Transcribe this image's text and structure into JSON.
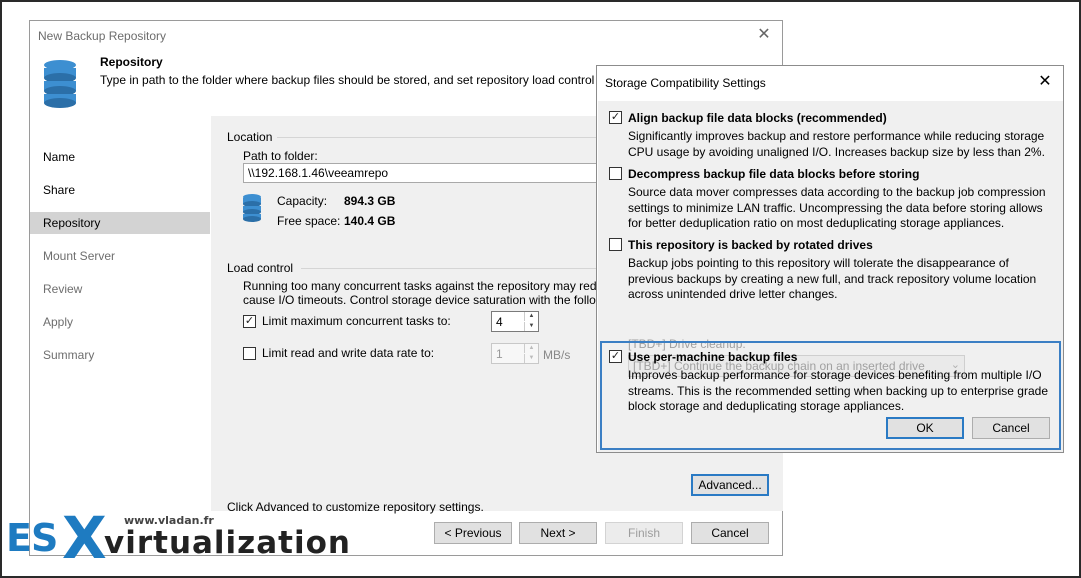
{
  "wizard": {
    "title": "New Backup Repository",
    "header_title": "Repository",
    "header_desc": "Type in path to the folder where backup files should be stored, and set repository load control",
    "nav": [
      {
        "label": "Name",
        "state": "normal"
      },
      {
        "label": "Share",
        "state": "normal"
      },
      {
        "label": "Repository",
        "state": "selected"
      },
      {
        "label": "Mount Server",
        "state": "disabled"
      },
      {
        "label": "Review",
        "state": "disabled"
      },
      {
        "label": "Apply",
        "state": "disabled"
      },
      {
        "label": "Summary",
        "state": "disabled"
      }
    ],
    "location": {
      "section_label": "Location",
      "path_label": "Path to folder:",
      "path_value": "\\\\192.168.1.46\\veeamrepo",
      "capacity_label": "Capacity:",
      "capacity_value": "894.3 GB",
      "free_label": "Free space:",
      "free_value": "140.4 GB"
    },
    "load_control": {
      "section_label": "Load control",
      "desc_line1": "Running too many concurrent tasks against the repository may red",
      "desc_line2": "cause I/O timeouts. Control storage device saturation with the follo",
      "limit_tasks_label": "Limit maximum concurrent tasks to:",
      "limit_tasks_checked": true,
      "limit_tasks_value": "4",
      "limit_rate_label": "Limit read and write data rate to:",
      "limit_rate_checked": false,
      "limit_rate_value": "1",
      "rate_unit": "MB/s"
    },
    "advanced_text": "Click Advanced to customize repository settings.",
    "buttons": {
      "advanced": "Advanced...",
      "previous": "< Previous",
      "next": "Next >",
      "finish": "Finish",
      "cancel": "Cancel"
    }
  },
  "dialog": {
    "title": "Storage Compatibility Settings",
    "options": [
      {
        "title": "Align backup file data blocks (recommended)",
        "checked": true,
        "desc": "Significantly improves backup and restore performance while reducing storage CPU usage by avoiding unaligned I/O. Increases backup size by less than 2%."
      },
      {
        "title": "Decompress backup file data blocks before storing",
        "checked": false,
        "desc": "Source data mover compresses data according to the backup job compression settings to minimize LAN traffic. Uncompressing the data before storing allows for better deduplication ratio on most deduplicating storage appliances."
      },
      {
        "title": "This repository is backed by rotated drives",
        "checked": false,
        "desc": "Backup jobs pointing to this repository will tolerate the disappearance of previous backups by creating a new full, and track repository volume location across unintended drive letter changes."
      },
      {
        "title": "Use per-machine backup files",
        "checked": true,
        "desc": "Improves backup performance for storage devices benefiting from multiple I/O streams. This is the recommended setting when backing up to enterprise grade block storage and deduplicating storage appliances."
      }
    ],
    "drive_cleanup_label": "[TBD+] Drive cleanup:",
    "drive_cleanup_value": "[TBD+] Continue the backup chain on an inserted drive",
    "buttons": {
      "ok": "OK",
      "cancel": "Cancel"
    }
  },
  "logo": {
    "es": "ES",
    "x": "X",
    "virtualization": "virtualization",
    "url": "www.vladan.fr"
  },
  "colors": {
    "accent": "#3b7fc4",
    "logo_blue": "#1e7bc1",
    "selected_nav": "#d3d3d3",
    "panel_bg": "#f0f0f0"
  }
}
